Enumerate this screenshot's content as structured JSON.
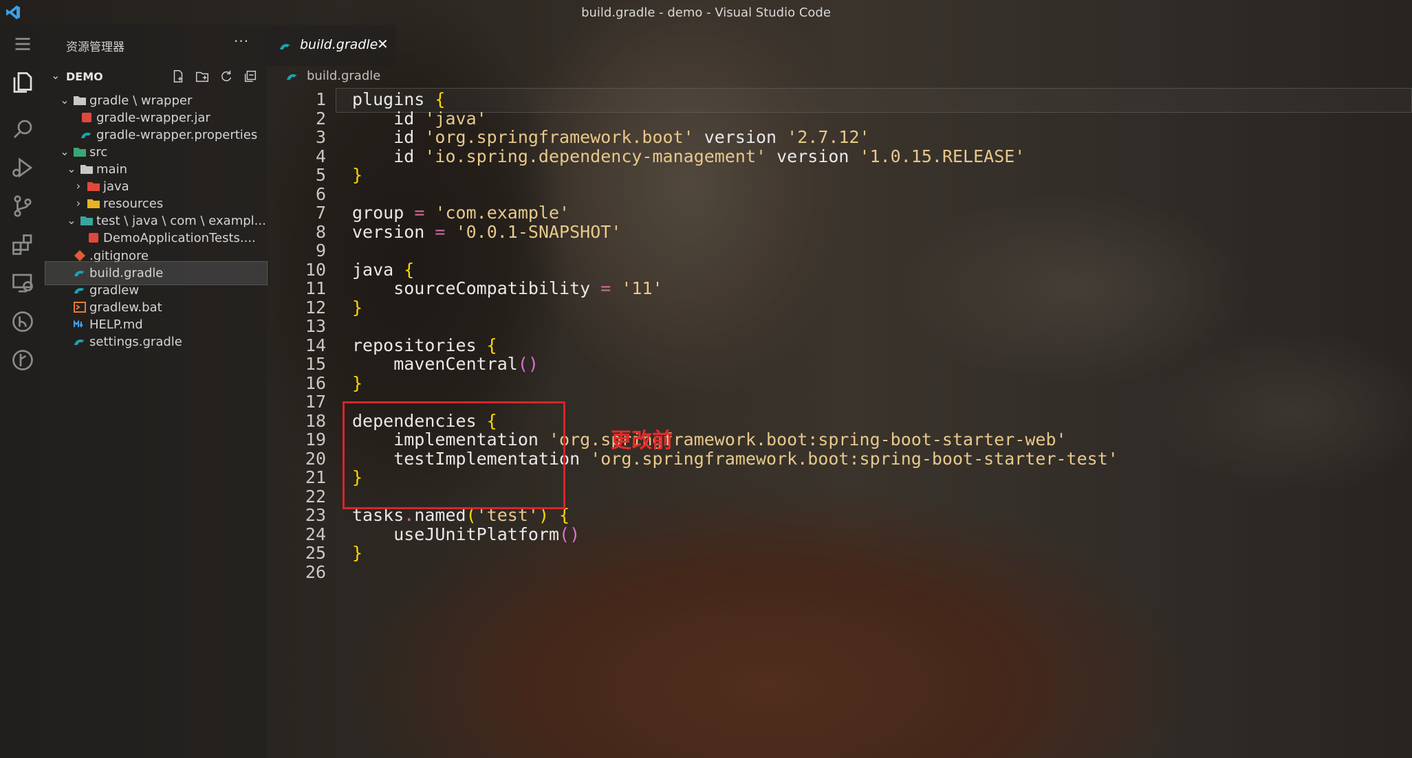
{
  "window": {
    "title": "build.gradle - demo - Visual Studio Code"
  },
  "activity_bar": {
    "items": [
      {
        "name": "explorer-icon",
        "active": true
      },
      {
        "name": "search-icon"
      },
      {
        "name": "run-debug-icon"
      },
      {
        "name": "source-control-icon"
      },
      {
        "name": "extensions-icon"
      },
      {
        "name": "remote-explorer-icon"
      },
      {
        "name": "gradle-icon"
      },
      {
        "name": "git-graph-icon"
      }
    ]
  },
  "sidebar": {
    "title": "资源管理器",
    "more": "···",
    "section": "DEMO",
    "tree": [
      {
        "label": "gradle \\ wrapper",
        "level": 1,
        "twistie": "⌄",
        "icon": "folder-icon"
      },
      {
        "label": "gradle-wrapper.jar",
        "level": 2,
        "icon": "jar-icon"
      },
      {
        "label": "gradle-wrapper.properties",
        "level": 2,
        "icon": "gradle-file-icon"
      },
      {
        "label": "src",
        "level": 1,
        "twistie": "⌄",
        "icon": "src-folder-icon"
      },
      {
        "label": "main",
        "level": 2,
        "twistie": "⌄",
        "icon": "folder-icon"
      },
      {
        "label": "java",
        "level": 3,
        "twistie": "›",
        "icon": "java-folder-icon"
      },
      {
        "label": "resources",
        "level": 3,
        "twistie": "›",
        "icon": "resources-folder-icon"
      },
      {
        "label": "test \\ java \\ com \\ exampl...",
        "level": 2,
        "twistie": "⌄",
        "icon": "test-folder-icon"
      },
      {
        "label": "DemoApplicationTests....",
        "level": 3,
        "icon": "java-file-icon"
      },
      {
        "label": ".gitignore",
        "level": 1,
        "icon": "git-icon"
      },
      {
        "label": "build.gradle",
        "level": 1,
        "icon": "gradle-file-icon",
        "selected": true
      },
      {
        "label": "gradlew",
        "level": 1,
        "icon": "gradle-file-icon"
      },
      {
        "label": "gradlew.bat",
        "level": 1,
        "icon": "terminal-file-icon"
      },
      {
        "label": "HELP.md",
        "level": 1,
        "icon": "markdown-icon"
      },
      {
        "label": "settings.gradle",
        "level": 1,
        "icon": "gradle-file-icon"
      }
    ]
  },
  "editor": {
    "tab": {
      "label": "build.gradle",
      "close": "✕"
    },
    "breadcrumb": "build.gradle",
    "lines": [
      "1",
      "2",
      "3",
      "4",
      "5",
      "6",
      "7",
      "8",
      "9",
      "10",
      "11",
      "12",
      "13",
      "14",
      "15",
      "16",
      "17",
      "18",
      "19",
      "20",
      "21",
      "22",
      "23",
      "24",
      "25",
      "26"
    ],
    "code": [
      [
        {
          "t": "plugins ",
          "c": "kw"
        },
        {
          "t": "{",
          "c": "br1"
        }
      ],
      [
        {
          "t": "    id ",
          "c": "kw"
        },
        {
          "t": "'java'",
          "c": "str"
        }
      ],
      [
        {
          "t": "    id ",
          "c": "kw"
        },
        {
          "t": "'org.springframework.boot'",
          "c": "str"
        },
        {
          "t": " version ",
          "c": "kw"
        },
        {
          "t": "'2.7.12'",
          "c": "str"
        }
      ],
      [
        {
          "t": "    id ",
          "c": "kw"
        },
        {
          "t": "'io.spring.dependency-management'",
          "c": "str"
        },
        {
          "t": " version ",
          "c": "kw"
        },
        {
          "t": "'1.0.15.RELEASE'",
          "c": "str"
        }
      ],
      [
        {
          "t": "}",
          "c": "br1"
        }
      ],
      [],
      [
        {
          "t": "group ",
          "c": "kw"
        },
        {
          "t": "=",
          "c": "op"
        },
        {
          "t": " ",
          "c": "kw"
        },
        {
          "t": "'com.example'",
          "c": "str"
        }
      ],
      [
        {
          "t": "version ",
          "c": "kw"
        },
        {
          "t": "=",
          "c": "op"
        },
        {
          "t": " ",
          "c": "kw"
        },
        {
          "t": "'0.0.1-SNAPSHOT'",
          "c": "str"
        }
      ],
      [],
      [
        {
          "t": "java ",
          "c": "kw"
        },
        {
          "t": "{",
          "c": "br1"
        }
      ],
      [
        {
          "t": "    sourceCompatibility ",
          "c": "kw"
        },
        {
          "t": "=",
          "c": "op"
        },
        {
          "t": " ",
          "c": "kw"
        },
        {
          "t": "'11'",
          "c": "str"
        }
      ],
      [
        {
          "t": "}",
          "c": "br1"
        }
      ],
      [],
      [
        {
          "t": "repositories ",
          "c": "kw"
        },
        {
          "t": "{",
          "c": "br1"
        }
      ],
      [
        {
          "t": "    mavenCentral",
          "c": "kw"
        },
        {
          "t": "()",
          "c": "br2"
        }
      ],
      [
        {
          "t": "}",
          "c": "br1"
        }
      ],
      [],
      [
        {
          "t": "dependencies ",
          "c": "kw"
        },
        {
          "t": "{",
          "c": "br1"
        }
      ],
      [
        {
          "t": "    implementation ",
          "c": "kw"
        },
        {
          "t": "'org.springframework.boot:spring-boot-starter-web'",
          "c": "str"
        }
      ],
      [
        {
          "t": "    testImplementation ",
          "c": "kw"
        },
        {
          "t": "'org.springframework.boot:spring-boot-starter-test'",
          "c": "str"
        }
      ],
      [
        {
          "t": "}",
          "c": "br1"
        }
      ],
      [],
      [
        {
          "t": "tasks",
          "c": "kw"
        },
        {
          "t": ".",
          "c": "dot"
        },
        {
          "t": "named",
          "c": "kw"
        },
        {
          "t": "(",
          "c": "br1"
        },
        {
          "t": "'test'",
          "c": "str"
        },
        {
          "t": ")",
          "c": "br1"
        },
        {
          "t": " ",
          "c": "kw"
        },
        {
          "t": "{",
          "c": "br1"
        }
      ],
      [
        {
          "t": "    useJUnitPlatform",
          "c": "kw"
        },
        {
          "t": "()",
          "c": "br2"
        }
      ],
      [
        {
          "t": "}",
          "c": "br1"
        }
      ],
      []
    ],
    "annotation": "更改前"
  },
  "colors": {
    "highlight_box": "#d9252a",
    "annotation": "#e52b2b",
    "string": "#e8c88a",
    "bracket": "#ffd700"
  }
}
